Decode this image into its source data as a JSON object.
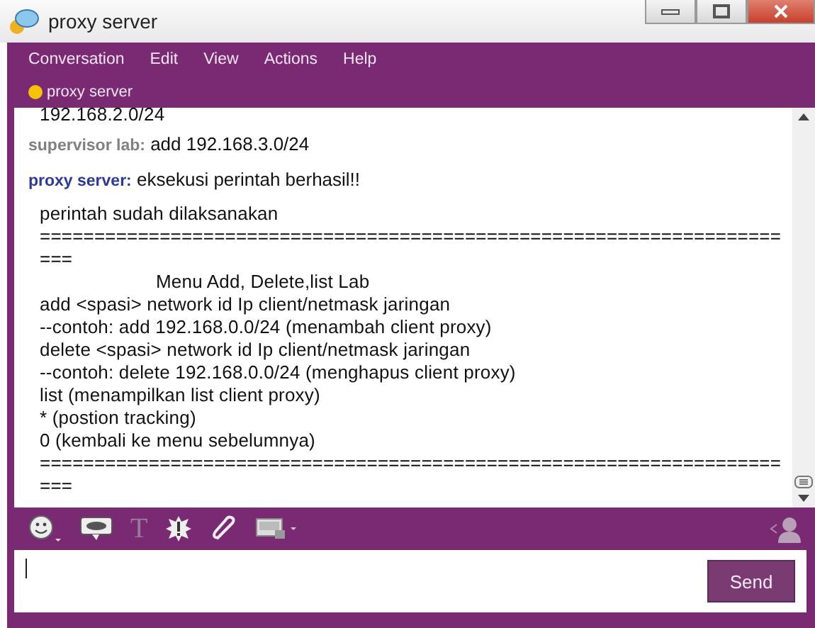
{
  "window": {
    "title": "proxy server"
  },
  "menu": [
    "Conversation",
    "Edit",
    "View",
    "Actions",
    "Help"
  ],
  "contact": {
    "name": "proxy server",
    "color": "#f5c400"
  },
  "transcript": [
    {
      "kind": "line",
      "text": "192.168.2.0/24"
    },
    {
      "kind": "message",
      "sender": "supervisor lab:",
      "color": "#808080",
      "text": "add 192.168.3.0/24"
    },
    {
      "kind": "message",
      "sender": "proxy server:",
      "color": "#2b3a9a",
      "text": "eksekusi perintah berhasil!!"
    },
    {
      "kind": "line",
      "text": "perintah sudah dilaksanakan"
    },
    {
      "kind": "line",
      "text": "===================================================================="
    },
    {
      "kind": "line",
      "text": "==="
    },
    {
      "kind": "heading",
      "text": "Menu Add, Delete,list Lab"
    },
    {
      "kind": "line",
      "text": "add <spasi> network id Ip client/netmask jaringan"
    },
    {
      "kind": "line",
      "text": "--contoh: add 192.168.0.0/24 (menambah client proxy)"
    },
    {
      "kind": "line",
      "text": "delete <spasi> network id Ip client/netmask jaringan"
    },
    {
      "kind": "line",
      "text": "--contoh: delete 192.168.0.0/24 (menghapus client proxy)"
    },
    {
      "kind": "line",
      "text": "list (menampilkan list client proxy)"
    },
    {
      "kind": "line",
      "text": "* (postion tracking)"
    },
    {
      "kind": "line",
      "text": "0 (kembali ke menu sebelumnya)"
    },
    {
      "kind": "line",
      "text": "===================================================================="
    },
    {
      "kind": "line",
      "text": "==="
    }
  ],
  "toolbar": {
    "format_glyph": "T"
  },
  "send_button": "Send"
}
